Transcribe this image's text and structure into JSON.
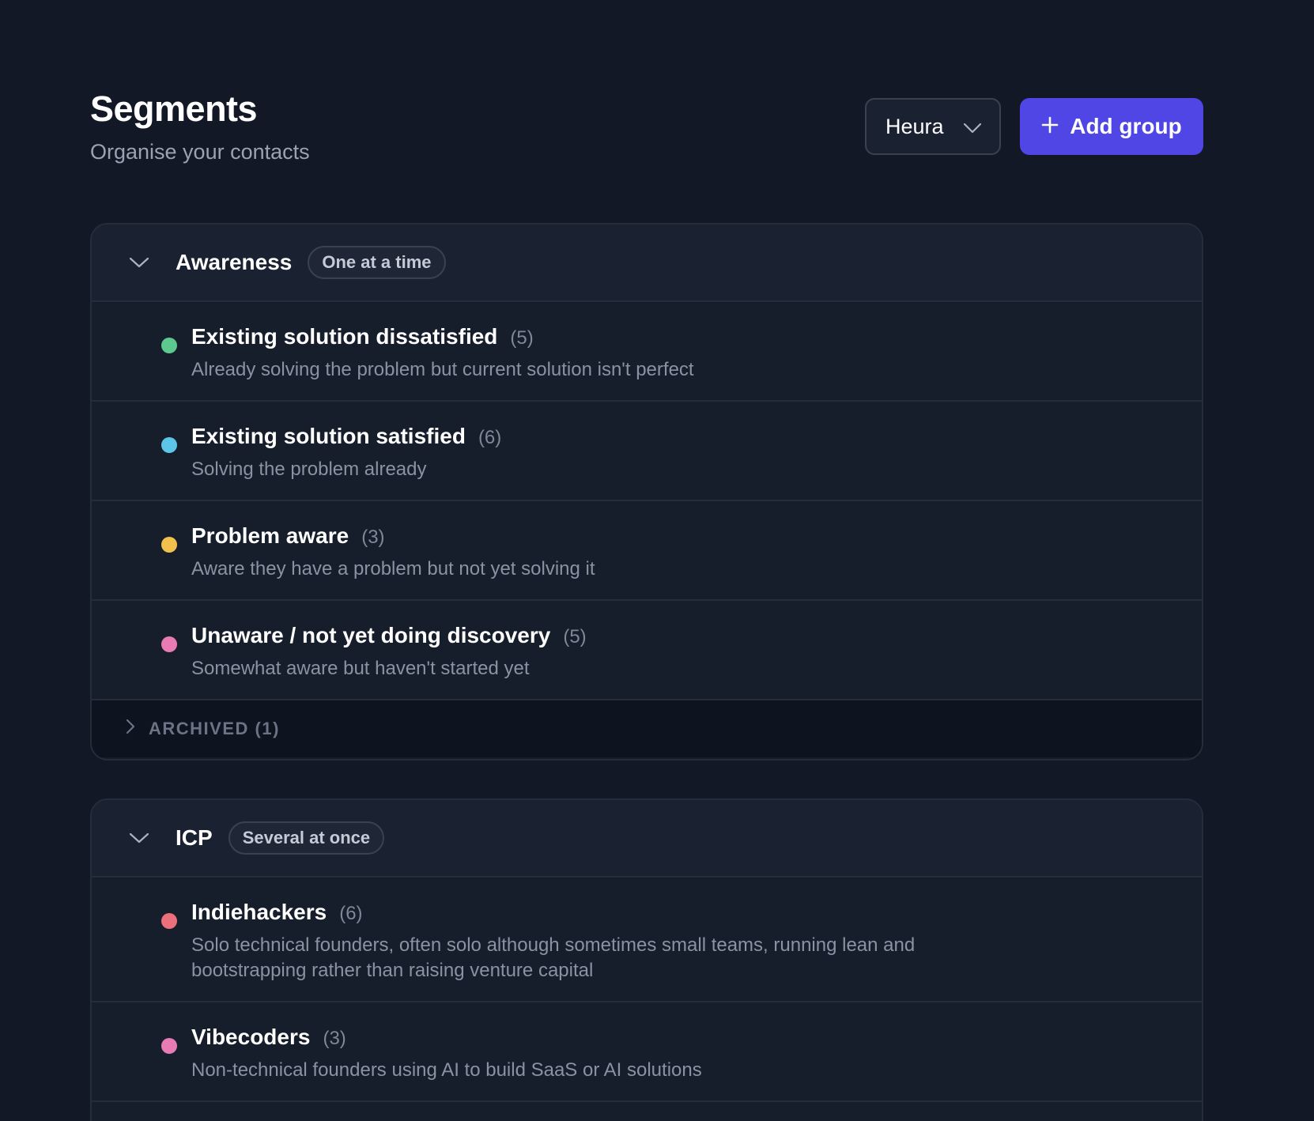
{
  "header": {
    "title": "Segments",
    "subtitle": "Organise your contacts",
    "project_select_value": "Heura",
    "add_group_label": "Add group"
  },
  "colors": {
    "background": "#121826",
    "accent": "#4f46e5",
    "dot_green": "#5cc98f",
    "dot_cyan": "#5cc6e8",
    "dot_yellow": "#f2c04c",
    "dot_pink": "#e97bb4",
    "dot_red": "#ec6f7c"
  },
  "groups": [
    {
      "name": "Awareness",
      "mode": "One at a time",
      "segments": [
        {
          "name": "Existing solution dissatisfied",
          "count": "(5)",
          "description": "Already solving the problem but current solution isn't perfect",
          "color": "#5cc98f"
        },
        {
          "name": "Existing solution satisfied",
          "count": "(6)",
          "description": "Solving the problem already",
          "color": "#5cc6e8"
        },
        {
          "name": "Problem aware",
          "count": "(3)",
          "description": "Aware they have a problem but not yet solving it",
          "color": "#f2c04c"
        },
        {
          "name": "Unaware / not yet doing discovery",
          "count": "(5)",
          "description": "Somewhat aware but haven't started yet",
          "color": "#e97bb4"
        }
      ],
      "archived_label": "ARCHIVED (1)"
    },
    {
      "name": "ICP",
      "mode": "Several at once",
      "segments": [
        {
          "name": "Indiehackers",
          "count": "(6)",
          "description": "Solo technical founders, often solo although sometimes small teams, running lean and bootstrapping rather than raising venture capital",
          "color": "#ec6f7c"
        },
        {
          "name": "Vibecoders",
          "count": "(3)",
          "description": "Non-technical founders using AI to build SaaS or AI solutions",
          "color": "#e97bb4"
        }
      ]
    }
  ]
}
